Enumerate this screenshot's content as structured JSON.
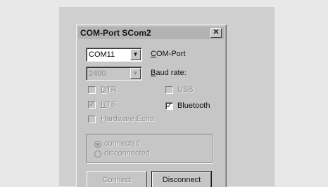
{
  "window": {
    "title": "COM-Port SCom2",
    "close_label": "✕"
  },
  "port": {
    "selected": "COM11",
    "label_access": "C",
    "label_rest": "OM-Port"
  },
  "baud": {
    "selected": "2400",
    "label_access": "B",
    "label_rest": "aud rate:"
  },
  "checkboxes": {
    "dtr": {
      "access": "D",
      "rest": "TR",
      "checked": false,
      "enabled": false
    },
    "rts": {
      "access": "R",
      "rest": "TS",
      "checked": true,
      "enabled": false
    },
    "hardware_echo": {
      "access": "H",
      "rest": "ardware Echo",
      "checked": false,
      "enabled": false
    },
    "usb": {
      "label": "USB",
      "checked": false,
      "enabled": false
    },
    "bluetooth": {
      "label": "Bluetooth",
      "checked": true,
      "enabled": true
    }
  },
  "status": {
    "connected": "connected",
    "disconnected": "disconnected",
    "selected": "connected"
  },
  "buttons": {
    "connect": "Connect",
    "disconnect": "Disconnect"
  },
  "icons": {
    "check": "✓",
    "dropdown": "▼"
  }
}
